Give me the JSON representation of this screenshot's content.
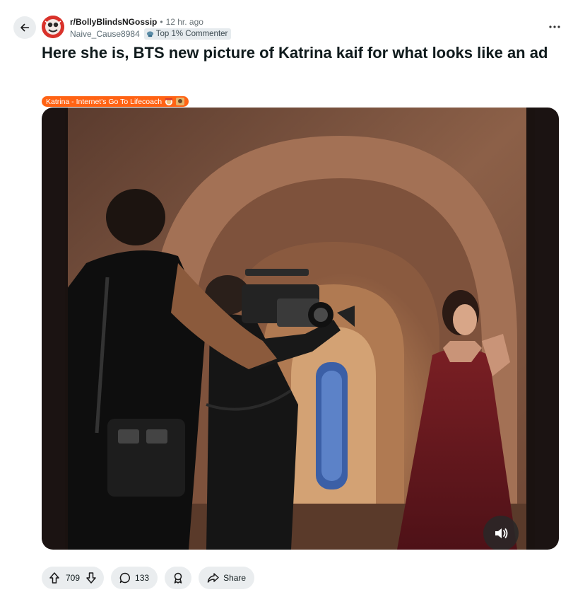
{
  "post": {
    "subreddit": "r/BollyBlindsNGossip",
    "separator": "•",
    "time": "12 hr. ago",
    "author": "Naive_Cause8984",
    "author_badge": "Top 1% Commenter",
    "title": "Here she is, BTS new picture of Katrina kaif for what looks like an ad",
    "flair": "Katrina - Internet's Go To Lifecoach",
    "flair_color": "#ff6314"
  },
  "media": {
    "type": "video",
    "audio_state": "muted"
  },
  "actions": {
    "upvotes": "709",
    "comments": "133",
    "share_label": "Share"
  },
  "icons": {
    "back": "arrow-left-icon",
    "more": "more-horizontal-icon",
    "upvote": "upvote-arrow-icon",
    "downvote": "downvote-arrow-icon",
    "comment": "comment-bubble-icon",
    "award": "award-icon",
    "share": "share-arrow-icon",
    "audio": "speaker-icon"
  }
}
